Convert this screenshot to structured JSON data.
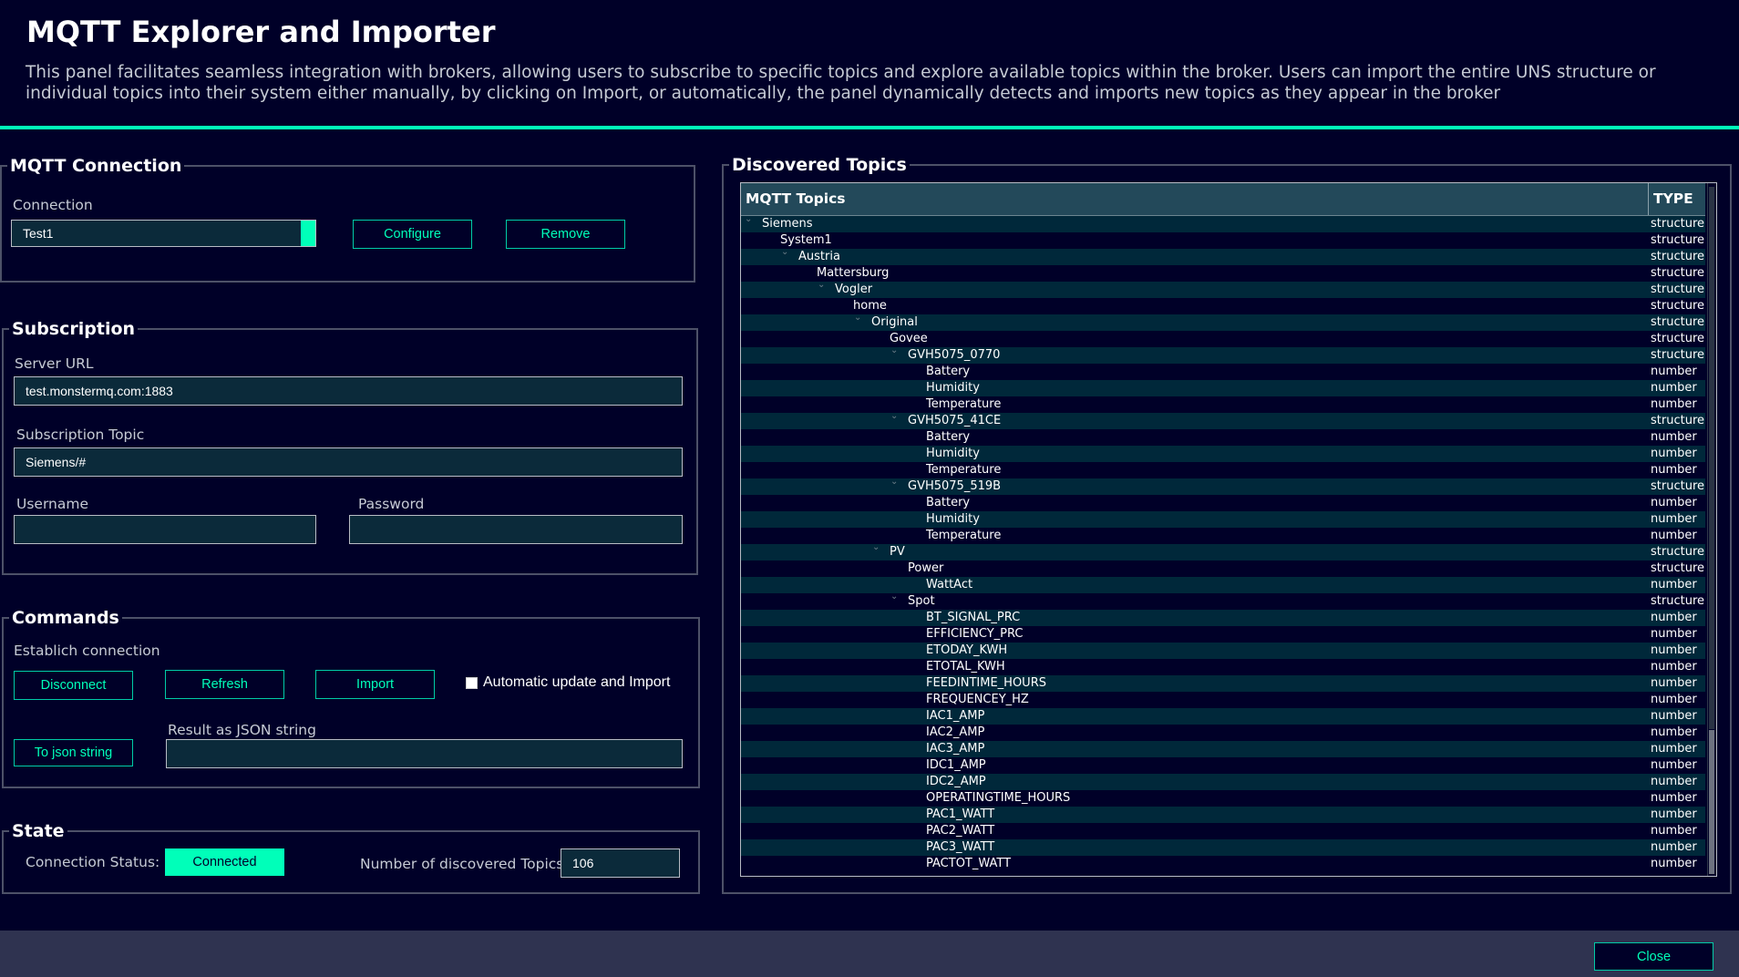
{
  "header": {
    "title": "MQTT Explorer and Importer",
    "description": "This panel facilitates seamless integration with brokers, allowing users to subscribe to specific topics and explore available topics within the broker. Users can import the entire UNS structure or individual topics into their system either manually, by clicking on Import, or automatically, the panel dynamically detects and imports new topics as they appear in the broker"
  },
  "connection": {
    "legend": "MQTT Connection",
    "label": "Connection",
    "value": "Test1",
    "configure_label": "Configure",
    "remove_label": "Remove"
  },
  "subscription": {
    "legend": "Subscription",
    "server_url_label": "Server URL",
    "server_url_value": "test.monstermq.com:1883",
    "topic_label": "Subscription Topic",
    "topic_value": "Siemens/#",
    "username_label": "Username",
    "username_value": "",
    "password_label": "Password",
    "password_value": ""
  },
  "commands": {
    "legend": "Commands",
    "establish_label": "Establich connection",
    "disconnect_label": "Disconnect",
    "refresh_label": "Refresh",
    "import_label": "Import",
    "auto_update_label": "Automatic update and Import",
    "auto_update_checked": false,
    "to_json_label": "To json string",
    "result_label": "Result as JSON string",
    "result_value": ""
  },
  "state": {
    "legend": "State",
    "connection_status_label": "Connection Status:",
    "connection_status_value": "Connected",
    "discovered_label": "Number of discovered Topics:",
    "discovered_value": "106"
  },
  "discovered": {
    "legend": "Discovered Topics",
    "col_topics": "MQTT Topics",
    "col_type": "TYPE",
    "rows": [
      {
        "name": "Siemens",
        "level": 0,
        "expanded": true,
        "type": "structure"
      },
      {
        "name": "System1",
        "level": 1,
        "expanded": false,
        "type": "structure"
      },
      {
        "name": "Austria",
        "level": 2,
        "expanded": true,
        "type": "structure"
      },
      {
        "name": "Mattersburg",
        "level": 3,
        "expanded": false,
        "type": "structure"
      },
      {
        "name": "Vogler",
        "level": 4,
        "expanded": true,
        "type": "structure"
      },
      {
        "name": "home",
        "level": 5,
        "expanded": false,
        "type": "structure"
      },
      {
        "name": "Original",
        "level": 6,
        "expanded": true,
        "type": "structure"
      },
      {
        "name": "Govee",
        "level": 7,
        "expanded": false,
        "type": "structure"
      },
      {
        "name": "GVH5075_0770",
        "level": 8,
        "expanded": true,
        "type": "structure"
      },
      {
        "name": "Battery",
        "level": 9,
        "expanded": false,
        "type": "number"
      },
      {
        "name": "Humidity",
        "level": 9,
        "expanded": false,
        "type": "number"
      },
      {
        "name": "Temperature",
        "level": 9,
        "expanded": false,
        "type": "number"
      },
      {
        "name": "GVH5075_41CE",
        "level": 8,
        "expanded": true,
        "type": "structure"
      },
      {
        "name": "Battery",
        "level": 9,
        "expanded": false,
        "type": "number"
      },
      {
        "name": "Humidity",
        "level": 9,
        "expanded": false,
        "type": "number"
      },
      {
        "name": "Temperature",
        "level": 9,
        "expanded": false,
        "type": "number"
      },
      {
        "name": "GVH5075_519B",
        "level": 8,
        "expanded": true,
        "type": "structure"
      },
      {
        "name": "Battery",
        "level": 9,
        "expanded": false,
        "type": "number"
      },
      {
        "name": "Humidity",
        "level": 9,
        "expanded": false,
        "type": "number"
      },
      {
        "name": "Temperature",
        "level": 9,
        "expanded": false,
        "type": "number"
      },
      {
        "name": "PV",
        "level": 7,
        "expanded": true,
        "type": "structure"
      },
      {
        "name": "Power",
        "level": 8,
        "expanded": false,
        "type": "structure"
      },
      {
        "name": "WattAct",
        "level": 9,
        "expanded": false,
        "type": "number"
      },
      {
        "name": "Spot",
        "level": 8,
        "expanded": true,
        "type": "structure"
      },
      {
        "name": "BT_SIGNAL_PRC",
        "level": 9,
        "expanded": false,
        "type": "number"
      },
      {
        "name": "EFFICIENCY_PRC",
        "level": 9,
        "expanded": false,
        "type": "number"
      },
      {
        "name": "ETODAY_KWH",
        "level": 9,
        "expanded": false,
        "type": "number"
      },
      {
        "name": "ETOTAL_KWH",
        "level": 9,
        "expanded": false,
        "type": "number"
      },
      {
        "name": "FEEDINTIME_HOURS",
        "level": 9,
        "expanded": false,
        "type": "number"
      },
      {
        "name": "FREQUENCEY_HZ",
        "level": 9,
        "expanded": false,
        "type": "number"
      },
      {
        "name": "IAC1_AMP",
        "level": 9,
        "expanded": false,
        "type": "number"
      },
      {
        "name": "IAC2_AMP",
        "level": 9,
        "expanded": false,
        "type": "number"
      },
      {
        "name": "IAC3_AMP",
        "level": 9,
        "expanded": false,
        "type": "number"
      },
      {
        "name": "IDC1_AMP",
        "level": 9,
        "expanded": false,
        "type": "number"
      },
      {
        "name": "IDC2_AMP",
        "level": 9,
        "expanded": false,
        "type": "number"
      },
      {
        "name": "OPERATINGTIME_HOURS",
        "level": 9,
        "expanded": false,
        "type": "number"
      },
      {
        "name": "PAC1_WATT",
        "level": 9,
        "expanded": false,
        "type": "number"
      },
      {
        "name": "PAC2_WATT",
        "level": 9,
        "expanded": false,
        "type": "number"
      },
      {
        "name": "PAC3_WATT",
        "level": 9,
        "expanded": false,
        "type": "number"
      },
      {
        "name": "PACTOT_WATT",
        "level": 9,
        "expanded": false,
        "type": "number"
      }
    ]
  },
  "footer": {
    "close_label": "Close"
  },
  "colors": {
    "background": "#000028",
    "accent": "#00ffb9",
    "button_border": "#00cca7",
    "field_bg": "#0b2a3a",
    "tree_header_bg": "#23495a",
    "tree_odd_row_bg": "#00283a",
    "footer_bg": "#2f3350"
  }
}
